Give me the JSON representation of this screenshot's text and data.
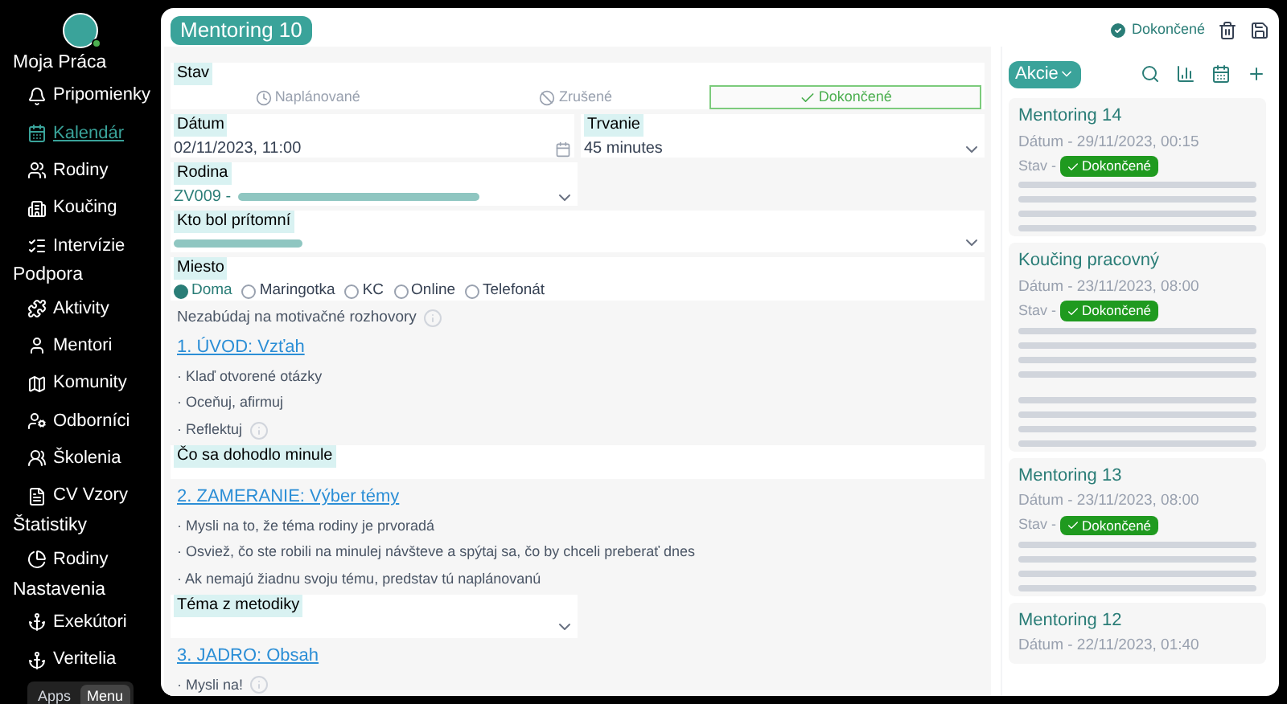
{
  "sidebar": {
    "groups": [
      {
        "title": "Moja Práca",
        "items": [
          {
            "label": "Pripomienky",
            "selected": false
          },
          {
            "label": "Kalendár",
            "selected": true
          },
          {
            "label": "Rodiny",
            "selected": false
          },
          {
            "label": "Koučing",
            "selected": false
          },
          {
            "label": "Intervízie",
            "selected": false
          }
        ]
      },
      {
        "title": "Podpora",
        "items": [
          {
            "label": "Aktivity",
            "selected": false
          },
          {
            "label": "Mentori",
            "selected": false
          },
          {
            "label": "Komunity",
            "selected": false
          },
          {
            "label": "Odborníci",
            "selected": false
          },
          {
            "label": "Školenia",
            "selected": false
          },
          {
            "label": "CV Vzory",
            "selected": false
          }
        ]
      },
      {
        "title": "Štatistiky",
        "items": [
          {
            "label": "Rodiny",
            "selected": false
          }
        ]
      },
      {
        "title": "Nastavenia",
        "items": [
          {
            "label": "Exekútori",
            "selected": false
          },
          {
            "label": "Veritelia",
            "selected": false
          }
        ]
      }
    ],
    "switch": [
      {
        "label": "Apps",
        "selected": false
      },
      {
        "label": "Menu",
        "selected": true
      }
    ]
  },
  "header": {
    "title": "Mentoring 10",
    "status": "Dokončené"
  },
  "form": {
    "stav": {
      "label": "Stav",
      "options": [
        {
          "label": "Naplánované",
          "selected": false
        },
        {
          "label": "Zrušené",
          "selected": false
        },
        {
          "label": "Dokončené",
          "selected": true
        }
      ]
    },
    "datum": {
      "label": "Dátum",
      "value": "02/11/2023, 11:00"
    },
    "trvanie": {
      "label": "Trvanie",
      "value": "45 minutes"
    },
    "rodina": {
      "label": "Rodina",
      "value": "ZV009 -"
    },
    "pritomni": {
      "label": "Kto bol prítomní"
    },
    "miesto": {
      "label": "Miesto",
      "options": [
        {
          "label": "Doma",
          "selected": true
        },
        {
          "label": "Maringotka",
          "selected": false
        },
        {
          "label": "KC",
          "selected": false
        },
        {
          "label": "Online",
          "selected": false
        },
        {
          "label": "Telefonát",
          "selected": false
        }
      ]
    },
    "sections": [
      {
        "kind": "note",
        "text": "Nezabúdaj na motivačné rozhovory",
        "info": true
      },
      {
        "kind": "heading",
        "text": "1. ÚVOD: Vzťah"
      },
      {
        "kind": "bullet",
        "text": "· Klaď otvorené otázky",
        "info": false
      },
      {
        "kind": "bullet",
        "text": "· Oceňuj, afirmuj",
        "info": false
      },
      {
        "kind": "bullet",
        "text": "· Reflektuj",
        "info": true
      },
      {
        "kind": "textarea",
        "label": "Čo sa dohodlo minule"
      },
      {
        "kind": "heading",
        "text": "2. ZAMERANIE: Výber témy"
      },
      {
        "kind": "bullet",
        "text": "· Mysli na to, že téma rodiny je prvoradá",
        "info": false
      },
      {
        "kind": "bullet",
        "text": "· Osviež, čo ste robili na minulej návšteve a spýtaj sa, čo by chceli preberať dnes",
        "info": false
      },
      {
        "kind": "bullet",
        "text": "· Ak nemajú žiadnu svoju tému, predstav tú naplánovanú",
        "info": false
      },
      {
        "kind": "select",
        "label": "Téma z metodiky"
      },
      {
        "kind": "heading",
        "text": "3. JADRO: Obsah"
      },
      {
        "kind": "bullet",
        "text": "· Mysli na!",
        "info": true
      }
    ]
  },
  "panel": {
    "actions": "Akcie",
    "cards": [
      {
        "title": "Mentoring 14",
        "date": "Dátum - 29/11/2023, 00:15",
        "stav_label": "Stav -",
        "stav": "Dokončené",
        "note_lines": [
          {
            "kind": "redacted"
          },
          {
            "kind": "redacted"
          },
          {
            "kind": "redacted"
          },
          {
            "kind": "redacted"
          }
        ]
      },
      {
        "title": "Koučing pracovný",
        "date": "Dátum - 23/11/2023, 08:00",
        "stav_label": "Stav -",
        "stav": "Dokončené",
        "note_lines": [
          {
            "kind": "redacted"
          },
          {
            "kind": "redacted"
          },
          {
            "kind": "redacted"
          },
          {
            "kind": "redacted"
          },
          {
            "kind": "gap"
          },
          {
            "kind": "redacted"
          },
          {
            "kind": "redacted"
          },
          {
            "kind": "redacted"
          },
          {
            "kind": "redacted"
          }
        ]
      },
      {
        "title": "Mentoring 13",
        "date": "Dátum - 23/11/2023, 08:00",
        "stav_label": "Stav -",
        "stav": "Dokončené",
        "note_lines": [
          {
            "kind": "redacted"
          },
          {
            "kind": "redacted"
          },
          {
            "kind": "redacted"
          },
          {
            "kind": "redacted"
          }
        ]
      },
      {
        "title": "Mentoring 12",
        "date": "Dátum - 22/11/2023, 01:40"
      }
    ]
  }
}
